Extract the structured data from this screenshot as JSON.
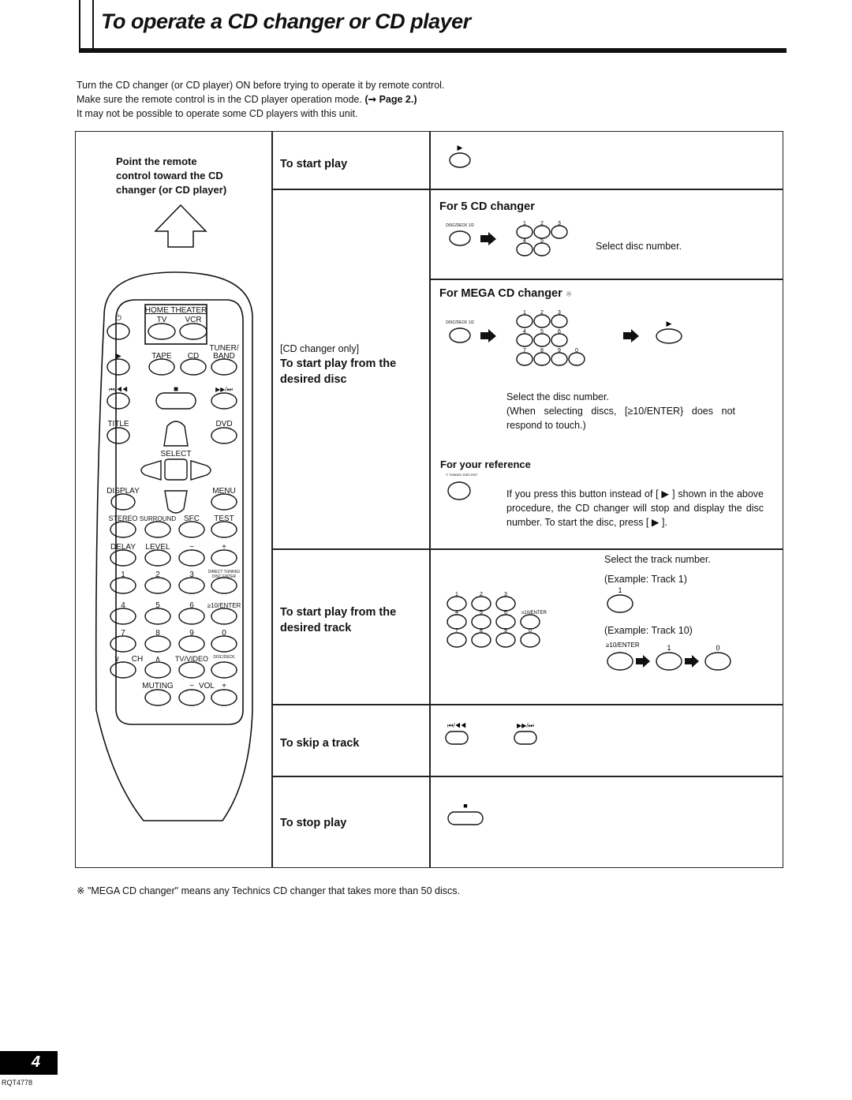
{
  "header": {
    "title": "To operate a CD changer or CD player"
  },
  "intro": {
    "line1": "Turn the CD changer (or CD player) ON before trying to operate it by remote control.",
    "line2_prefix": "Make sure the remote control is in the CD player operation mode.",
    "line2_ref": "(➞ Page 2.)",
    "line3": "It may not be possible to operate some CD players with this unit."
  },
  "remote_panel": {
    "instruction": [
      "Point the remote",
      "control toward the CD",
      "changer (or CD player)"
    ],
    "home_theater_label": "HOME THEATER",
    "buttons": {
      "power": "⏻",
      "tv": "TV",
      "vcr": "VCR",
      "play": "▶",
      "tape": "TAPE",
      "cd": "CD",
      "tuner1": "TUNER/",
      "tuner2": "BAND",
      "skip_back": "⏮/◀◀",
      "stop": "■",
      "skip_fwd": "▶▶/⏭",
      "title": "TITLE",
      "dvd": "DVD",
      "select": "SELECT",
      "display": "DISPLAY",
      "menu": "MENU",
      "stereo": "STEREO",
      "surround": "SURROUND",
      "sfc": "SFC",
      "test": "TEST",
      "delay": "DELAY",
      "level": "LEVEL",
      "minus": "−",
      "plus": "+",
      "n1": "1",
      "n2": "2",
      "n3": "3",
      "direct1": "DIRECT TUNING/",
      "direct2": "DISC ENTER",
      "n4": "4",
      "n5": "5",
      "n6": "6",
      "enter": "≥10/ENTER",
      "n7": "7",
      "n8": "8",
      "n9": "9",
      "n0": "0",
      "ch_down": "∨",
      "ch": "CH",
      "ch_up": "∧",
      "tvvideo": "TV/VIDEO",
      "discdeck": "DISC/DECK",
      "muting": "MUTING",
      "vol_minus": "−",
      "vol": "VOL",
      "vol_plus": "+"
    }
  },
  "rows": [
    {
      "label": "To start play",
      "button": "▶"
    },
    {
      "pre_label": "[CD changer only]",
      "label": "To start play from the desired disc",
      "five_cd": {
        "heading": "For 5 CD changer",
        "deck_button": "DISC/DECK 1/2",
        "digits": [
          "1",
          "2",
          "3",
          "4",
          "5"
        ],
        "note": "Select disc number."
      },
      "mega_cd": {
        "heading": "For MEGA CD changer",
        "mark": "※",
        "deck_button": "DISC/DECK 1/2",
        "digits": [
          "1",
          "2",
          "3",
          "4",
          "5",
          "6",
          "7",
          "8",
          "9",
          "0"
        ],
        "play": "▶",
        "note1": "Select the disc number.",
        "note2": "(When selecting discs, [≥10/ENTER} does not respond to touch.)"
      },
      "reference": {
        "heading": "For your reference",
        "button": "DIRECT TUNING/ DISC ENTER",
        "text": "If you press this button instead of [ ▶ ] shown in the above procedure, the CD changer will stop and display the disc number. To start the disc, press [ ▶ ]."
      }
    },
    {
      "label": "To start play from the desired track",
      "digits": [
        "1",
        "2",
        "3",
        "4",
        "5",
        "6",
        "7",
        "8",
        "9",
        "0"
      ],
      "enter": "≥10/ENTER",
      "note": "Select the track number.",
      "ex1": "(Example: Track 1)",
      "ex1_digit": "1",
      "ex2": "(Example: Track 10)",
      "ex2_seq": [
        "≥10/ENTER",
        "1",
        "0"
      ]
    },
    {
      "label": "To skip a track",
      "back": "⏮/◀◀",
      "fwd": "▶▶/⏭"
    },
    {
      "label": "To stop play",
      "button": "■"
    }
  ],
  "footnote": "※  \"MEGA CD changer\" means any Technics CD changer that takes more than 50 discs.",
  "footer": {
    "page_number": "4",
    "model_code": "RQT4778"
  }
}
